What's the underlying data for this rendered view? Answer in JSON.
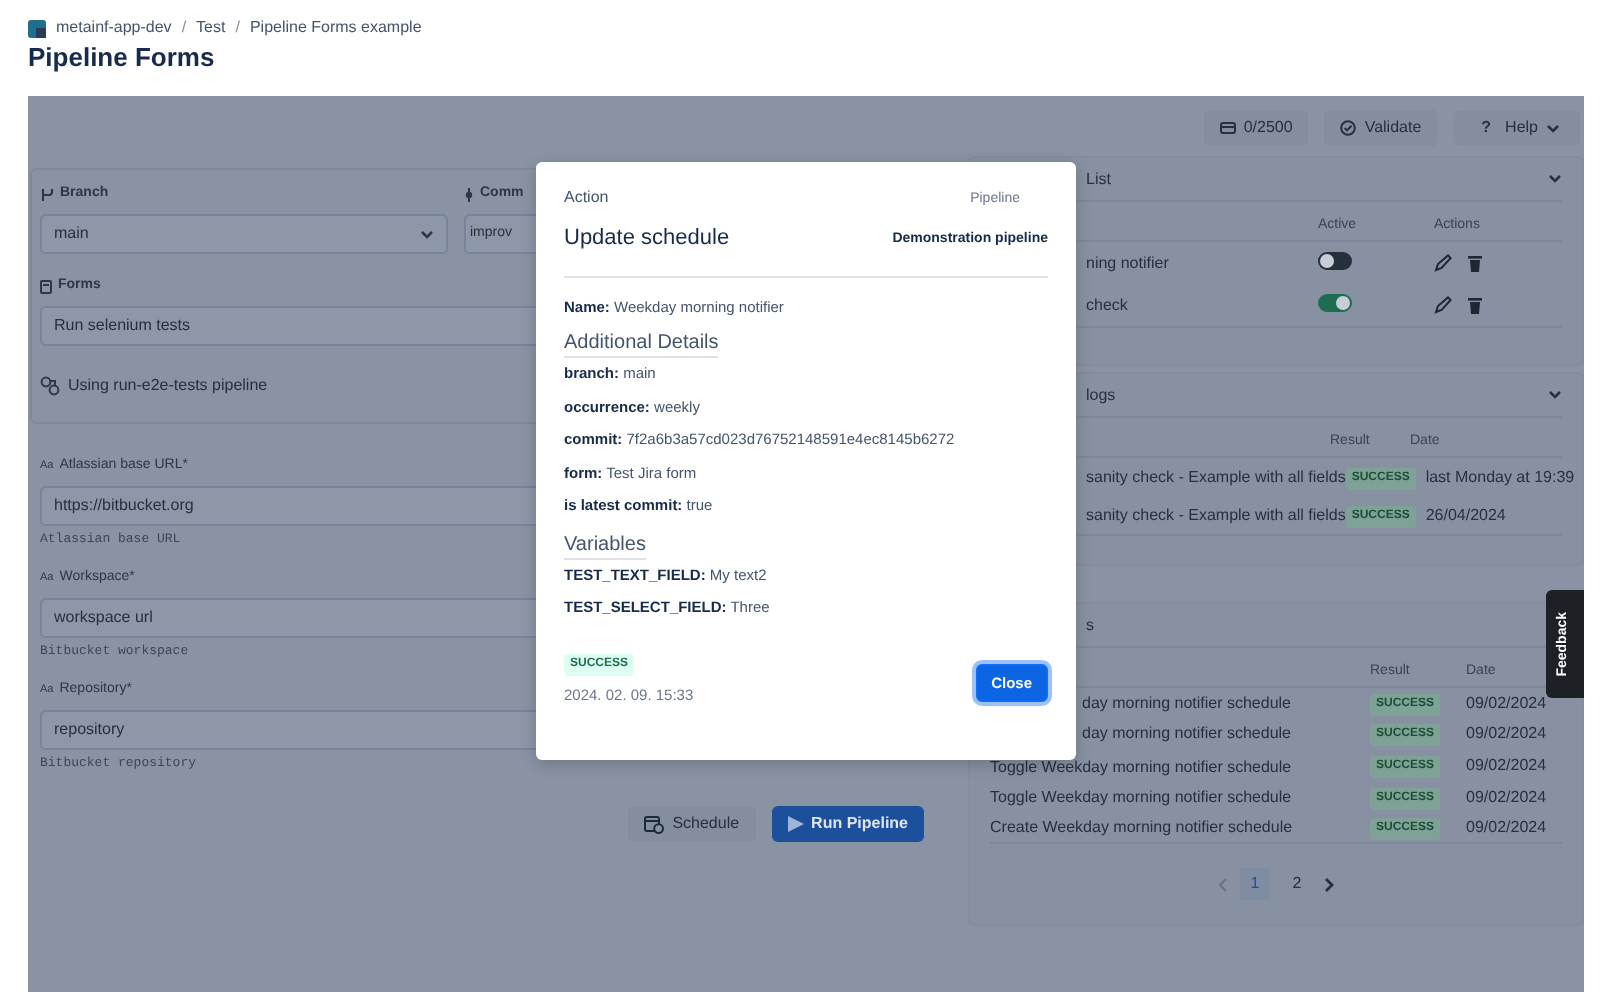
{
  "breadcrumb": [
    {
      "kind": "link",
      "text": "metainf-app-dev"
    },
    {
      "kind": "separator",
      "text": "/"
    },
    {
      "kind": "link",
      "text": "Test"
    },
    {
      "kind": "separator",
      "text": "/"
    },
    {
      "kind": "link",
      "text": "Pipeline Forms example"
    }
  ],
  "page_title": "Pipeline Forms",
  "toolbar": {
    "quota": "0/2500",
    "validate": "Validate",
    "help_glyph": "?",
    "help": "Help"
  },
  "pipeline_form": {
    "branch": {
      "label": "Branch",
      "value": "main"
    },
    "commit": {
      "label": "Comm",
      "value": "improv"
    },
    "forms": {
      "label": "Forms",
      "value": "Run selenium tests"
    },
    "pipeline_note": "Using run-e2e-tests pipeline",
    "fields": [
      {
        "type_glyph": "Aa",
        "label": "Atlassian base URL*",
        "value": "https://bitbucket.org",
        "help": "Atlassian base URL"
      },
      {
        "type_glyph": "Aa",
        "label": "Workspace*",
        "value": "workspace url",
        "help": "Bitbucket workspace"
      },
      {
        "type_glyph": "Aa",
        "label": "Repository*",
        "value": "repository",
        "help": "Bitbucket repository"
      }
    ],
    "buttons": {
      "schedule": "Schedule",
      "run": "Run Pipeline"
    }
  },
  "schedules_card": {
    "title": "List",
    "columns": [
      "Active",
      "Actions"
    ],
    "rows": [
      {
        "name": "ning notifier",
        "active": false
      },
      {
        "name": "check",
        "active": true
      }
    ]
  },
  "logs_card": {
    "title": "logs",
    "columns": [
      "Result",
      "Date"
    ],
    "rows": [
      {
        "name": "sanity check - Example with all fields",
        "result": "SUCCESS",
        "date": "last Monday at 19:39"
      },
      {
        "name": "sanity check - Example with all fields",
        "result": "SUCCESS",
        "date": "26/04/2024"
      }
    ]
  },
  "history_card": {
    "title": "s",
    "columns": [
      "Result",
      "Date"
    ],
    "rows": [
      {
        "name": "day morning notifier schedule",
        "result": "SUCCESS",
        "date": "09/02/2024"
      },
      {
        "name": "day morning notifier schedule",
        "result": "SUCCESS",
        "date": "09/02/2024"
      },
      {
        "name": "Toggle Weekday morning notifier schedule",
        "result": "SUCCESS",
        "date": "09/02/2024"
      },
      {
        "name": "Toggle Weekday morning notifier schedule",
        "result": "SUCCESS",
        "date": "09/02/2024"
      },
      {
        "name": "Create Weekday morning notifier schedule",
        "result": "SUCCESS",
        "date": "09/02/2024"
      }
    ],
    "pages": [
      {
        "label": "1",
        "selected": true
      },
      {
        "label": "2",
        "selected": false
      }
    ]
  },
  "feedback_tab": "Feedback",
  "modal": {
    "kicker": "Action",
    "title": "Update schedule",
    "pipeline_label": "Pipeline",
    "pipeline_name": "Demonstration pipeline",
    "name_line": "**Name:** Weekday morning notifier",
    "details_heading": "Additional Details",
    "details": [
      "**branch:** main",
      "**occurrence:** weekly",
      "**commit:** 7f2a6b3a57cd023d76752148591e4ec8145b6272",
      "**form:** Test Jira form",
      "**is latest commit:** true"
    ],
    "variables_heading": "Variables",
    "variables": [
      "**TEST_TEXT_FIELD:** My text2",
      "**TEST_SELECT_FIELD:** Three"
    ],
    "status": "SUCCESS",
    "timestamp": "2024. 02. 09. 15:33",
    "close": "Close"
  }
}
